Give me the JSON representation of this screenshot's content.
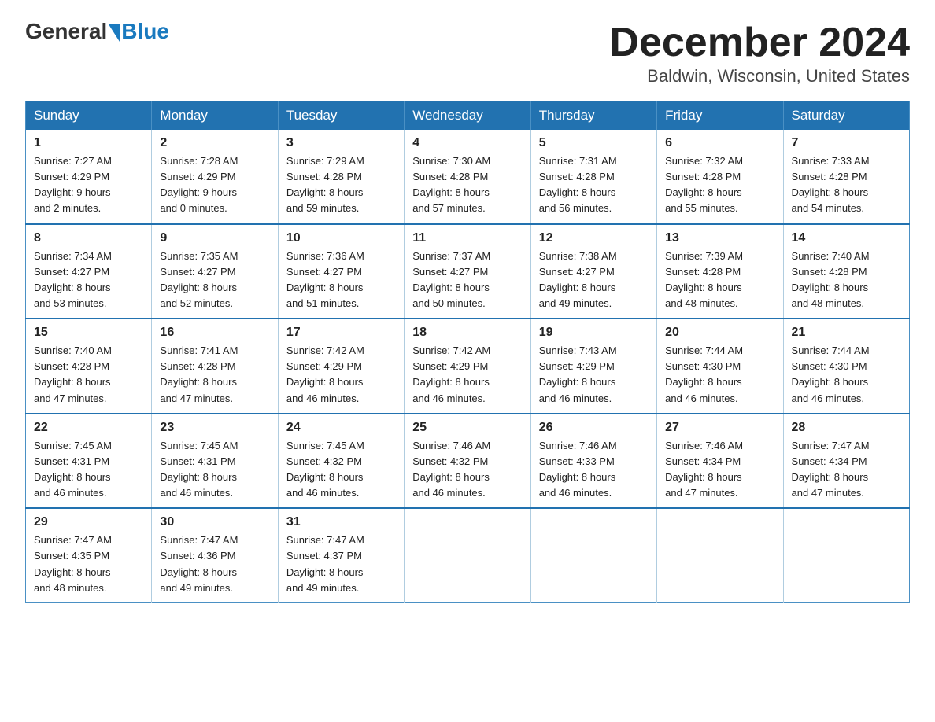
{
  "logo": {
    "general": "General",
    "blue": "Blue"
  },
  "header": {
    "title": "December 2024",
    "subtitle": "Baldwin, Wisconsin, United States"
  },
  "weekdays": [
    "Sunday",
    "Monday",
    "Tuesday",
    "Wednesday",
    "Thursday",
    "Friday",
    "Saturday"
  ],
  "weeks": [
    [
      {
        "day": "1",
        "sunrise": "7:27 AM",
        "sunset": "4:29 PM",
        "daylight": "9 hours and 2 minutes."
      },
      {
        "day": "2",
        "sunrise": "7:28 AM",
        "sunset": "4:29 PM",
        "daylight": "9 hours and 0 minutes."
      },
      {
        "day": "3",
        "sunrise": "7:29 AM",
        "sunset": "4:28 PM",
        "daylight": "8 hours and 59 minutes."
      },
      {
        "day": "4",
        "sunrise": "7:30 AM",
        "sunset": "4:28 PM",
        "daylight": "8 hours and 57 minutes."
      },
      {
        "day": "5",
        "sunrise": "7:31 AM",
        "sunset": "4:28 PM",
        "daylight": "8 hours and 56 minutes."
      },
      {
        "day": "6",
        "sunrise": "7:32 AM",
        "sunset": "4:28 PM",
        "daylight": "8 hours and 55 minutes."
      },
      {
        "day": "7",
        "sunrise": "7:33 AM",
        "sunset": "4:28 PM",
        "daylight": "8 hours and 54 minutes."
      }
    ],
    [
      {
        "day": "8",
        "sunrise": "7:34 AM",
        "sunset": "4:27 PM",
        "daylight": "8 hours and 53 minutes."
      },
      {
        "day": "9",
        "sunrise": "7:35 AM",
        "sunset": "4:27 PM",
        "daylight": "8 hours and 52 minutes."
      },
      {
        "day": "10",
        "sunrise": "7:36 AM",
        "sunset": "4:27 PM",
        "daylight": "8 hours and 51 minutes."
      },
      {
        "day": "11",
        "sunrise": "7:37 AM",
        "sunset": "4:27 PM",
        "daylight": "8 hours and 50 minutes."
      },
      {
        "day": "12",
        "sunrise": "7:38 AM",
        "sunset": "4:27 PM",
        "daylight": "8 hours and 49 minutes."
      },
      {
        "day": "13",
        "sunrise": "7:39 AM",
        "sunset": "4:28 PM",
        "daylight": "8 hours and 48 minutes."
      },
      {
        "day": "14",
        "sunrise": "7:40 AM",
        "sunset": "4:28 PM",
        "daylight": "8 hours and 48 minutes."
      }
    ],
    [
      {
        "day": "15",
        "sunrise": "7:40 AM",
        "sunset": "4:28 PM",
        "daylight": "8 hours and 47 minutes."
      },
      {
        "day": "16",
        "sunrise": "7:41 AM",
        "sunset": "4:28 PM",
        "daylight": "8 hours and 47 minutes."
      },
      {
        "day": "17",
        "sunrise": "7:42 AM",
        "sunset": "4:29 PM",
        "daylight": "8 hours and 46 minutes."
      },
      {
        "day": "18",
        "sunrise": "7:42 AM",
        "sunset": "4:29 PM",
        "daylight": "8 hours and 46 minutes."
      },
      {
        "day": "19",
        "sunrise": "7:43 AM",
        "sunset": "4:29 PM",
        "daylight": "8 hours and 46 minutes."
      },
      {
        "day": "20",
        "sunrise": "7:44 AM",
        "sunset": "4:30 PM",
        "daylight": "8 hours and 46 minutes."
      },
      {
        "day": "21",
        "sunrise": "7:44 AM",
        "sunset": "4:30 PM",
        "daylight": "8 hours and 46 minutes."
      }
    ],
    [
      {
        "day": "22",
        "sunrise": "7:45 AM",
        "sunset": "4:31 PM",
        "daylight": "8 hours and 46 minutes."
      },
      {
        "day": "23",
        "sunrise": "7:45 AM",
        "sunset": "4:31 PM",
        "daylight": "8 hours and 46 minutes."
      },
      {
        "day": "24",
        "sunrise": "7:45 AM",
        "sunset": "4:32 PM",
        "daylight": "8 hours and 46 minutes."
      },
      {
        "day": "25",
        "sunrise": "7:46 AM",
        "sunset": "4:32 PM",
        "daylight": "8 hours and 46 minutes."
      },
      {
        "day": "26",
        "sunrise": "7:46 AM",
        "sunset": "4:33 PM",
        "daylight": "8 hours and 46 minutes."
      },
      {
        "day": "27",
        "sunrise": "7:46 AM",
        "sunset": "4:34 PM",
        "daylight": "8 hours and 47 minutes."
      },
      {
        "day": "28",
        "sunrise": "7:47 AM",
        "sunset": "4:34 PM",
        "daylight": "8 hours and 47 minutes."
      }
    ],
    [
      {
        "day": "29",
        "sunrise": "7:47 AM",
        "sunset": "4:35 PM",
        "daylight": "8 hours and 48 minutes."
      },
      {
        "day": "30",
        "sunrise": "7:47 AM",
        "sunset": "4:36 PM",
        "daylight": "8 hours and 49 minutes."
      },
      {
        "day": "31",
        "sunrise": "7:47 AM",
        "sunset": "4:37 PM",
        "daylight": "8 hours and 49 minutes."
      },
      null,
      null,
      null,
      null
    ]
  ],
  "labels": {
    "sunrise": "Sunrise:",
    "sunset": "Sunset:",
    "daylight": "Daylight:"
  }
}
